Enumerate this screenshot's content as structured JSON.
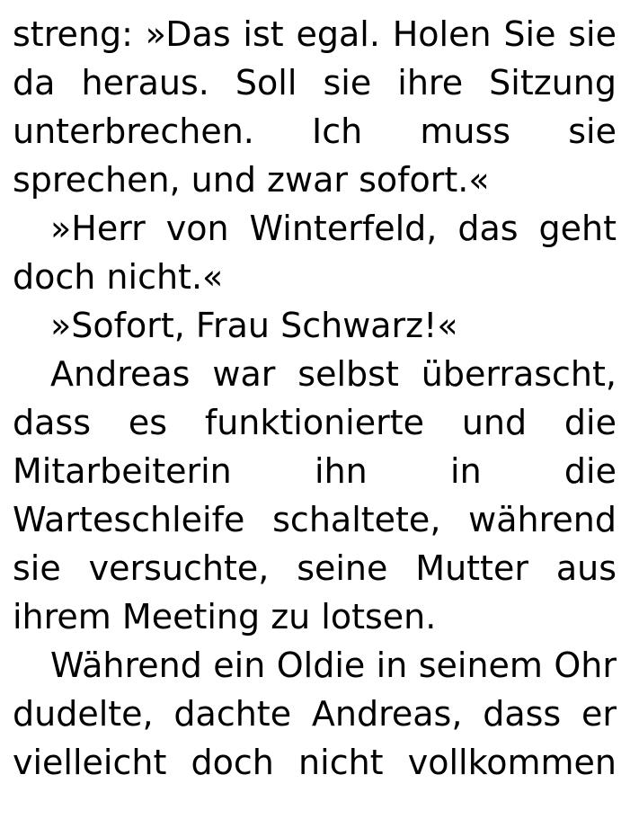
{
  "paragraphs": [
    {
      "indent": false,
      "lines": [
        "streng: »Das ist egal. Holen Sie sie",
        "da heraus. Soll sie ihre Sitzung",
        "unterbrechen. Ich muss sie",
        "sprechen, und zwar sofort.«"
      ]
    },
    {
      "indent": true,
      "lines": [
        "»Herr von Winterfeld, das geht",
        "doch nicht.«"
      ]
    },
    {
      "indent": true,
      "lines": [
        "»Sofort, Frau Schwarz!«"
      ]
    },
    {
      "indent": true,
      "lines": [
        "Andreas war selbst überrascht,",
        "dass es funktionierte und die",
        "Mitarbeiterin ihn in die",
        "Warteschleife schaltete, während",
        "sie versuchte, seine Mutter aus",
        "ihrem Meeting zu lotsen."
      ]
    },
    {
      "indent": true,
      "lines": [
        "Während ein Oldie in seinem Ohr",
        "dudelte, dachte Andreas, dass er",
        "vielleicht doch nicht vollkommen"
      ]
    }
  ]
}
